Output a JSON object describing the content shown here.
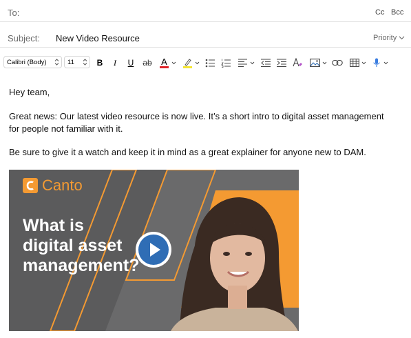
{
  "header": {
    "to_label": "To:",
    "cc_label": "Cc",
    "bcc_label": "Bcc",
    "subject_label": "Subject:",
    "subject_value": "New Video Resource",
    "priority_label": "Priority"
  },
  "toolbar": {
    "font_family": "Calibri (Body)",
    "font_size": "11",
    "bold": "B",
    "italic": "I",
    "underline": "U",
    "strikethrough": "ab",
    "font_color_glyph": "A",
    "font_color": "#e0242a",
    "highlight_color": "#f4e534",
    "dictate_color": "#3a7de0"
  },
  "message": {
    "greeting": "Hey team,",
    "para1": "Great news: Our latest video resource is now live. It’s a short intro to digital asset management for people not familiar with it.",
    "para2": "Be sure to give it a watch and keep it in mind as a great explainer for anyone new to DAM."
  },
  "video": {
    "logo_text": "Canto",
    "title_line1": "What is",
    "title_line2": "digital asset",
    "title_line3": "management?",
    "brand_color": "#f49a32",
    "play_color": "#2f6db5"
  }
}
